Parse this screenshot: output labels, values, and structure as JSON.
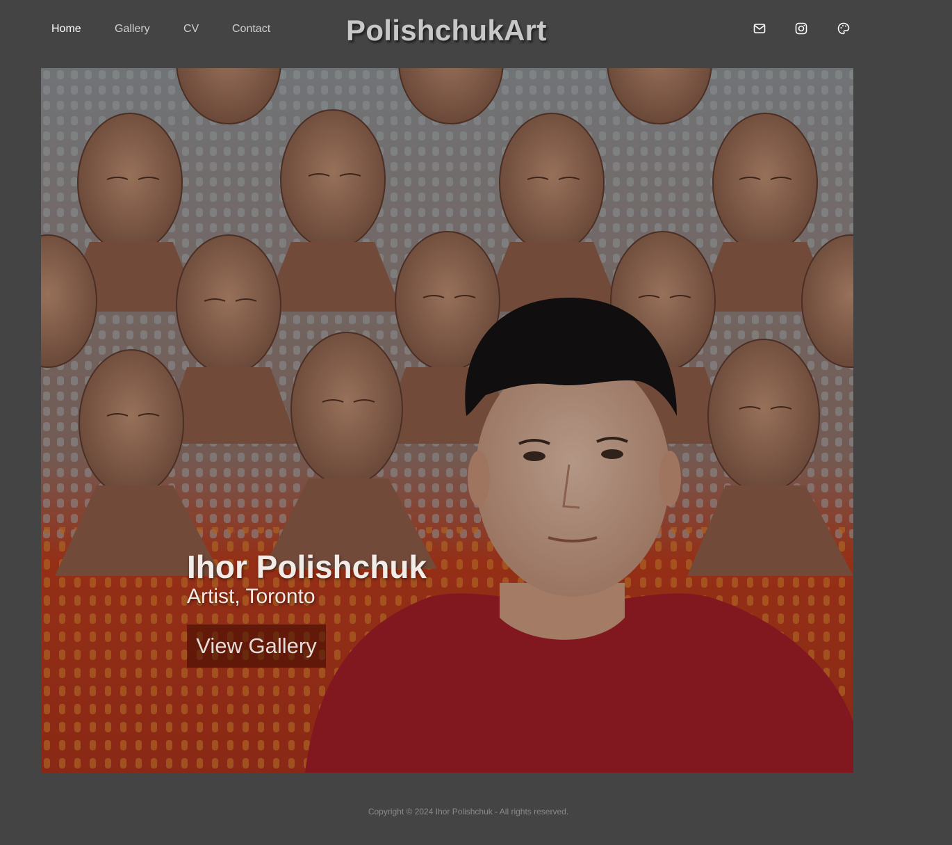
{
  "nav": {
    "items": [
      {
        "label": "Home",
        "active": true
      },
      {
        "label": "Gallery",
        "active": false
      },
      {
        "label": "CV",
        "active": false
      },
      {
        "label": "Contact",
        "active": false
      }
    ]
  },
  "brand": {
    "title": "PolishchukArt"
  },
  "social": {
    "icons": [
      "mail-icon",
      "instagram-icon",
      "palette-icon"
    ]
  },
  "hero": {
    "name": "Ihor Polishchuk",
    "subtitle": "Artist, Toronto",
    "button_label": "View Gallery"
  },
  "footer": {
    "copyright": "Copyright © 2024 Ihor Polishchuk - All rights reserved."
  },
  "colors": {
    "background": "#444444",
    "nav_text": "#cfcfcf",
    "nav_active": "#ffffff",
    "brand": "#c8c8c8"
  }
}
